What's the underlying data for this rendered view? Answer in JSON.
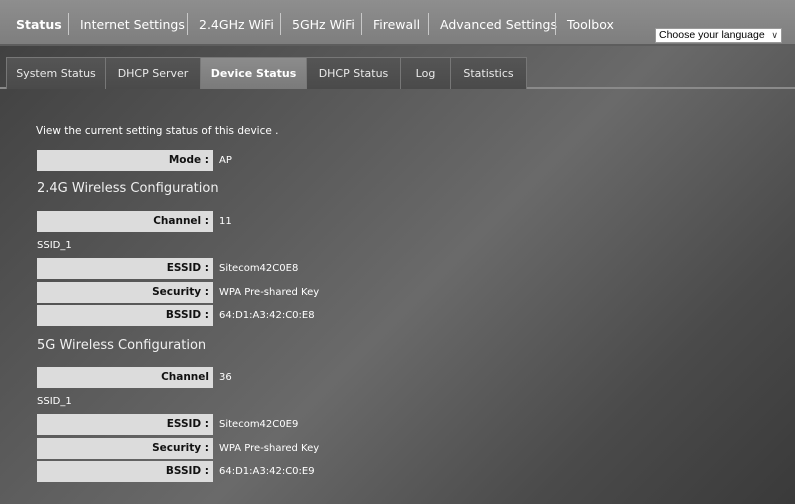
{
  "topnav": {
    "items": [
      "Status",
      "Internet Settings",
      "2.4GHz WiFi",
      "5GHz WiFi",
      "Firewall",
      "Advanced Settings",
      "Toolbox"
    ]
  },
  "language_select": {
    "value": "Choose your language"
  },
  "subtabs": [
    "System Status",
    "DHCP Server",
    "Device Status",
    "DHCP Status",
    "Log",
    "Statistics"
  ],
  "intro": "View the current setting status of this device .",
  "mode": {
    "label": "Mode :",
    "value": "AP"
  },
  "wifi24": {
    "title": "2.4G Wireless Configuration",
    "channel": {
      "label": "Channel :",
      "value": "11"
    },
    "ssid_label": "SSID_1",
    "essid": {
      "label": "ESSID :",
      "value": "Sitecom42C0E8"
    },
    "security": {
      "label": "Security :",
      "value": "WPA Pre-shared Key"
    },
    "bssid": {
      "label": "BSSID :",
      "value": "64:D1:A3:42:C0:E8"
    }
  },
  "wifi5": {
    "title": "5G Wireless Configuration",
    "channel": {
      "label": "Channel",
      "value": "36"
    },
    "ssid_label": "SSID_1",
    "essid": {
      "label": "ESSID :",
      "value": "Sitecom42C0E9"
    },
    "security": {
      "label": "Security :",
      "value": "WPA Pre-shared Key"
    },
    "bssid": {
      "label": "BSSID :",
      "value": "64:D1:A3:42:C0:E9"
    }
  }
}
